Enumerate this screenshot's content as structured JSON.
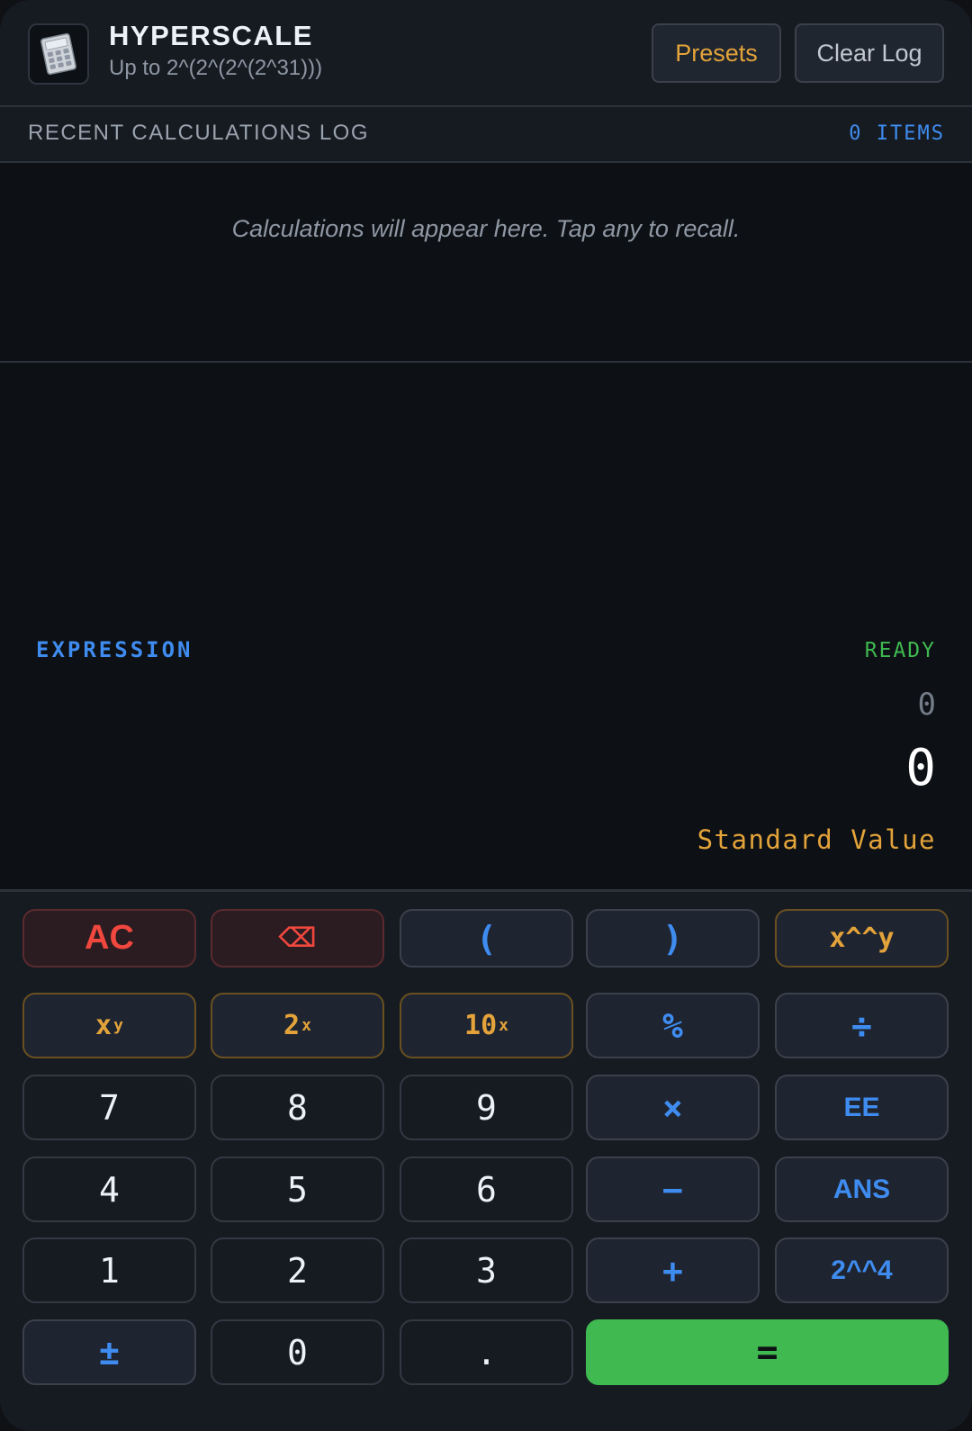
{
  "header": {
    "title": "HYPERSCALE",
    "subtitle": "Up to 2^(2^(2^(2^31)))",
    "presets_label": "Presets",
    "clear_log_label": "Clear Log"
  },
  "log": {
    "title": "RECENT CALCULATIONS LOG",
    "count": "0 ITEMS",
    "empty_message": "Calculations will appear here. Tap any to recall.",
    "entries": []
  },
  "display": {
    "expression_label": "EXPRESSION",
    "status": "READY",
    "expression": "0",
    "result": "0",
    "result_type": "Standard Value"
  },
  "keypad": {
    "ac": "AC",
    "backspace": "⌫",
    "open_paren": "(",
    "close_paren": ")",
    "tetration": "x^^y",
    "power_base": "x",
    "power_sup": "y",
    "two_base": "2",
    "two_sup": "x",
    "ten_base": "10",
    "ten_sup": "x",
    "percent": "%",
    "divide": "÷",
    "seven": "7",
    "eight": "8",
    "nine": "9",
    "multiply": "×",
    "ee": "EE",
    "four": "4",
    "five": "5",
    "six": "6",
    "subtract": "−",
    "ans": "ANS",
    "one": "1",
    "two": "2",
    "three": "3",
    "add": "+",
    "two_tet_four": "2^^4",
    "plus_minus": "±",
    "zero": "0",
    "decimal": ".",
    "equals": "="
  },
  "icons": {
    "app_icon": "calculator-icon"
  },
  "colors": {
    "accent_blue": "#3f8cf0",
    "accent_amber": "#e3a33a",
    "accent_green": "#3fb950",
    "accent_red": "#f0473e"
  }
}
